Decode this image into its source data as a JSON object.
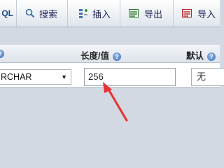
{
  "tabs": {
    "sql": {
      "label": "QL"
    },
    "search": {
      "label": "搜索"
    },
    "insert": {
      "label": "插入"
    },
    "export": {
      "label": "导出"
    },
    "import": {
      "label": "导入"
    }
  },
  "columns_header": {
    "length_value": "长度/值",
    "default": "默认",
    "help_glyph": "?"
  },
  "field": {
    "type_value": "RCHAR",
    "length_value": "256",
    "default_value": "无"
  },
  "annotation": {
    "color": "#e83030"
  }
}
